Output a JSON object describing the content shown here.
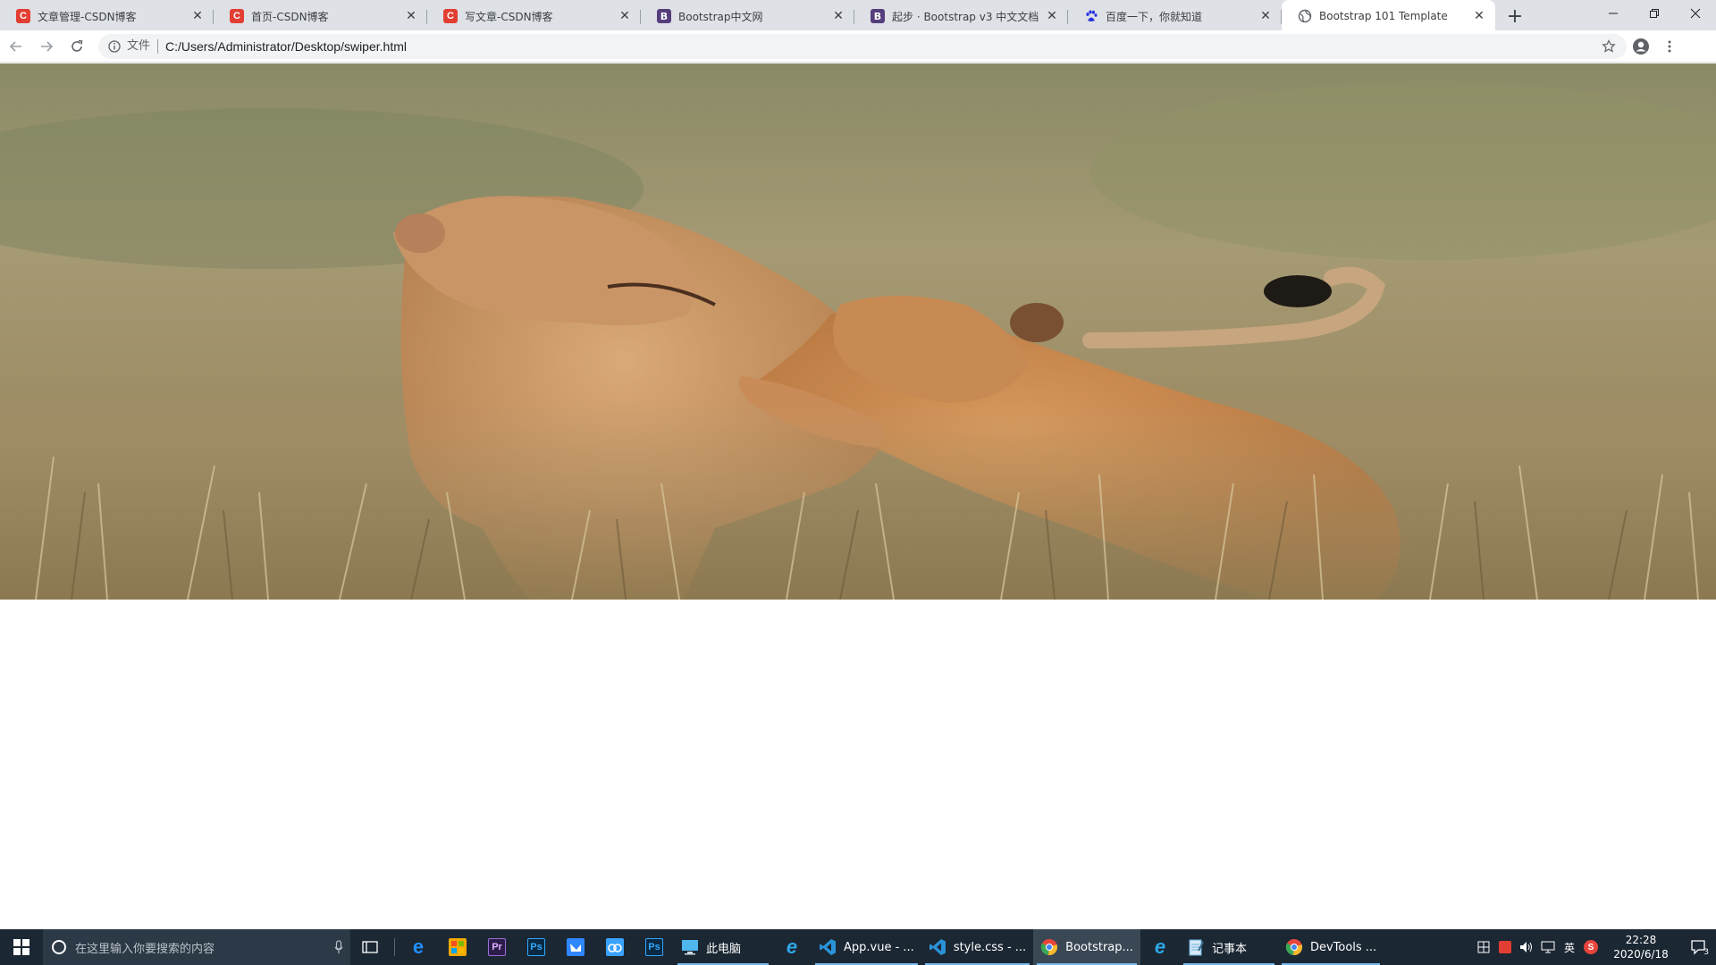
{
  "browser": {
    "tabs": [
      {
        "title": "文章管理-CSDN博客",
        "icon": "csdn-icon",
        "active": false
      },
      {
        "title": "首页-CSDN博客",
        "icon": "csdn-icon",
        "active": false
      },
      {
        "title": "写文章-CSDN博客",
        "icon": "csdn-icon",
        "active": false
      },
      {
        "title": "Bootstrap中文网",
        "icon": "bootstrap-icon",
        "active": false
      },
      {
        "title": "起步 · Bootstrap v3 中文文档",
        "icon": "bootstrap-icon",
        "active": false
      },
      {
        "title": "百度一下，你就知道",
        "icon": "baidu-paw-icon",
        "active": false
      },
      {
        "title": "Bootstrap 101 Template",
        "icon": "globe-icon",
        "active": true
      }
    ],
    "csdn_glyph": "C",
    "bootstrap_glyph": "B",
    "close_glyph": "✕",
    "new_tab_glyph": "+",
    "omnibox": {
      "security_label": "文件",
      "url": "C:/Users/Administrator/Desktop/swiper.html"
    }
  },
  "page": {
    "carousel_image_alt": ""
  },
  "taskbar": {
    "search_placeholder": "在这里输入你要搜索的内容",
    "apps": [
      {
        "key": "edge",
        "label": "",
        "glyph": "e",
        "color": "#1e90ff",
        "running": false
      },
      {
        "key": "store",
        "label": "",
        "glyph": "",
        "color": "#f2a900",
        "running": false
      },
      {
        "key": "premiere",
        "label": "",
        "glyph": "Pr",
        "color": "#2b1c4a",
        "running": false
      },
      {
        "key": "photoshop",
        "label": "",
        "glyph": "Ps",
        "color": "#0b2942",
        "running": false
      },
      {
        "key": "feishu",
        "label": "",
        "glyph": "",
        "color": "#2f87ff",
        "running": false
      },
      {
        "key": "baidu-netdisk",
        "label": "",
        "glyph": "",
        "color": "#3aa2ff",
        "running": false
      },
      {
        "key": "photoshop-2",
        "label": "",
        "glyph": "Ps",
        "color": "#0b2942",
        "running": false
      },
      {
        "key": "this-pc",
        "label": "此电脑",
        "glyph": "",
        "color": "#4fb6ee",
        "running": true
      },
      {
        "key": "ie",
        "label": "",
        "glyph": "e",
        "color": "#2fa8e8",
        "running": false
      },
      {
        "key": "vscode-app",
        "label": "App.vue - ...",
        "glyph": "",
        "color": "#2a93d8",
        "running": true
      },
      {
        "key": "vscode-style",
        "label": "style.css - ...",
        "glyph": "",
        "color": "#2a93d8",
        "running": true
      },
      {
        "key": "chrome-bootstrap",
        "label": "Bootstrap...",
        "glyph": "",
        "color": "#e8453c",
        "running": true,
        "active": true
      },
      {
        "key": "ie-2",
        "label": "",
        "glyph": "e",
        "color": "#2fa8e8",
        "running": false
      },
      {
        "key": "notepad",
        "label": "记事本",
        "glyph": "",
        "color": "#6ab0de",
        "running": true
      },
      {
        "key": "chrome-devtools",
        "label": "DevTools ...",
        "glyph": "",
        "color": "#e8453c",
        "running": true
      }
    ],
    "tray": {
      "ime_mode": "英",
      "clock_time": "22:28",
      "clock_date": "2020/6/18",
      "notification_count": "3"
    }
  }
}
